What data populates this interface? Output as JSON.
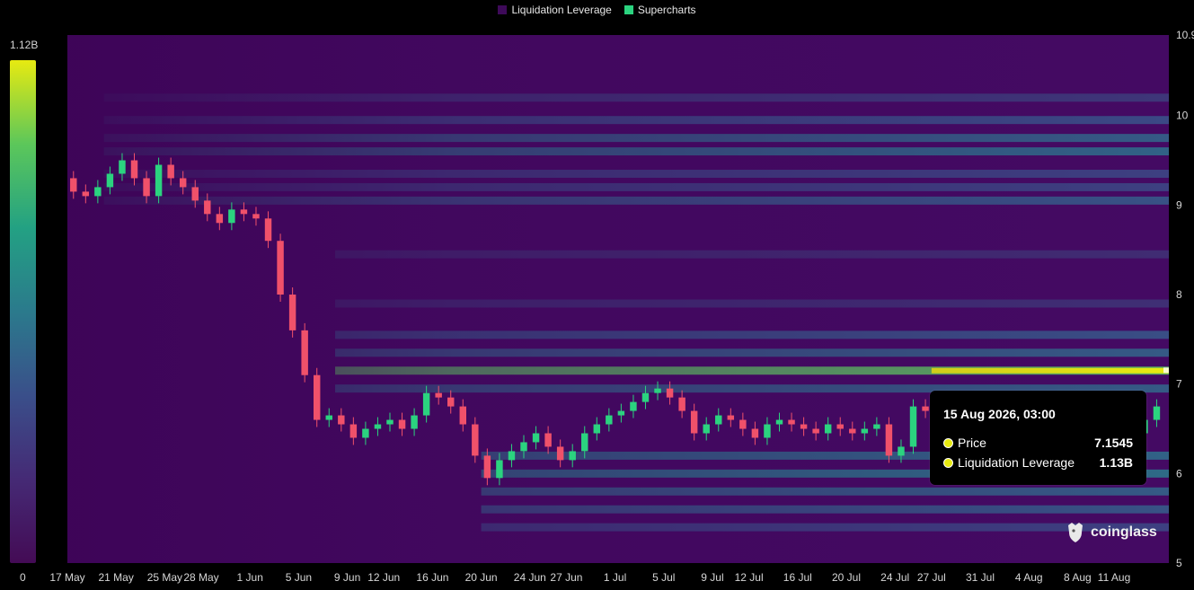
{
  "legend": [
    {
      "label": "Liquidation Leverage",
      "color": "#3e0a59"
    },
    {
      "label": "Supercharts",
      "color": "#2bd37f"
    }
  ],
  "colorbar": {
    "max_label": "1.12B",
    "min_label": "0",
    "colors": [
      "#e7ea11",
      "#5cc75a",
      "#23a183",
      "#2b7a8c",
      "#3a4f8a",
      "#452a75",
      "#440b55"
    ]
  },
  "tooltip": {
    "title": "15 Aug 2026, 03:00",
    "rows": [
      {
        "label": "Price",
        "value": "7.1545",
        "color": "#e7ea11"
      },
      {
        "label": "Liquidation Leverage",
        "value": "1.13B",
        "color": "#e7ea11"
      }
    ]
  },
  "brand": {
    "name": "coinglass",
    "icon": "coinglass-logo-icon"
  },
  "chart_data": {
    "type": "heatmap",
    "title": "",
    "xlabel": "",
    "ylabel": "",
    "x_tick_labels": [
      "17 May",
      "21 May",
      "25 May",
      "28 May",
      "1 Jun",
      "5 Jun",
      "9 Jun",
      "12 Jun",
      "16 Jun",
      "20 Jun",
      "24 Jun",
      "27 Jun",
      "1 Jul",
      "5 Jul",
      "9 Jul",
      "12 Jul",
      "16 Jul",
      "20 Jul",
      "24 Jul",
      "27 Jul",
      "31 Jul",
      "4 Aug",
      "8 Aug",
      "11 Aug"
    ],
    "x_range_days": [
      0,
      90.5
    ],
    "x_tick_days": [
      0,
      4,
      8,
      11,
      15,
      19,
      23,
      26,
      30,
      34,
      38,
      41,
      45,
      49,
      53,
      56,
      60,
      64,
      68,
      71,
      75,
      79,
      83,
      86
    ],
    "y_tick_labels": [
      "10.9",
      "10",
      "9",
      "8",
      "7",
      "6",
      "5"
    ],
    "y_tick_values": [
      10.9,
      10,
      9,
      8,
      7,
      6,
      5
    ],
    "ylim": [
      5,
      10.9
    ],
    "colorscale_max": 1120000000,
    "price_series": {
      "name": "Price",
      "points": [
        [
          0,
          9.3
        ],
        [
          1,
          9.15
        ],
        [
          2,
          9.1
        ],
        [
          3,
          9.2
        ],
        [
          4,
          9.35
        ],
        [
          5,
          9.5
        ],
        [
          6,
          9.3
        ],
        [
          7,
          9.1
        ],
        [
          8,
          9.45
        ],
        [
          9,
          9.3
        ],
        [
          10,
          9.2
        ],
        [
          11,
          9.05
        ],
        [
          12,
          8.9
        ],
        [
          13,
          8.8
        ],
        [
          14,
          8.95
        ],
        [
          15,
          8.9
        ],
        [
          16,
          8.85
        ],
        [
          17,
          8.6
        ],
        [
          18,
          8.0
        ],
        [
          19,
          7.6
        ],
        [
          20,
          7.1
        ],
        [
          21,
          6.6
        ],
        [
          22,
          6.65
        ],
        [
          23,
          6.55
        ],
        [
          24,
          6.4
        ],
        [
          25,
          6.5
        ],
        [
          26,
          6.55
        ],
        [
          27,
          6.6
        ],
        [
          28,
          6.5
        ],
        [
          29,
          6.65
        ],
        [
          30,
          6.9
        ],
        [
          31,
          6.85
        ],
        [
          32,
          6.75
        ],
        [
          33,
          6.55
        ],
        [
          34,
          6.2
        ],
        [
          35,
          5.95
        ],
        [
          36,
          6.15
        ],
        [
          37,
          6.25
        ],
        [
          38,
          6.35
        ],
        [
          39,
          6.45
        ],
        [
          40,
          6.3
        ],
        [
          41,
          6.15
        ],
        [
          42,
          6.25
        ],
        [
          43,
          6.45
        ],
        [
          44,
          6.55
        ],
        [
          45,
          6.65
        ],
        [
          46,
          6.7
        ],
        [
          47,
          6.8
        ],
        [
          48,
          6.9
        ],
        [
          49,
          6.95
        ],
        [
          50,
          6.85
        ],
        [
          51,
          6.7
        ],
        [
          52,
          6.45
        ],
        [
          53,
          6.55
        ],
        [
          54,
          6.65
        ],
        [
          55,
          6.6
        ],
        [
          56,
          6.5
        ],
        [
          57,
          6.4
        ],
        [
          58,
          6.55
        ],
        [
          59,
          6.6
        ],
        [
          60,
          6.55
        ],
        [
          61,
          6.5
        ],
        [
          62,
          6.45
        ],
        [
          63,
          6.55
        ],
        [
          64,
          6.5
        ],
        [
          65,
          6.45
        ],
        [
          66,
          6.5
        ],
        [
          67,
          6.55
        ],
        [
          68,
          6.2
        ],
        [
          69,
          6.3
        ],
        [
          70,
          6.75
        ],
        [
          71,
          6.7
        ],
        [
          72,
          6.65
        ],
        [
          73,
          6.75
        ],
        [
          74,
          6.8
        ],
        [
          75,
          6.7
        ],
        [
          76,
          6.6
        ],
        [
          77,
          6.65
        ],
        [
          78,
          6.6
        ],
        [
          79,
          6.5
        ],
        [
          80,
          6.55
        ],
        [
          81,
          6.6
        ],
        [
          82,
          6.55
        ],
        [
          83,
          6.6
        ],
        [
          84,
          6.5
        ],
        [
          85,
          6.45
        ],
        [
          86,
          6.5
        ],
        [
          87,
          6.55
        ],
        [
          88,
          6.45
        ],
        [
          89,
          6.6
        ],
        [
          90,
          6.75
        ]
      ]
    },
    "liquidation_bands": [
      {
        "price": 10.2,
        "intensity": 0.25
      },
      {
        "price": 9.95,
        "intensity": 0.35
      },
      {
        "price": 9.75,
        "intensity": 0.45
      },
      {
        "price": 9.6,
        "intensity": 0.5
      },
      {
        "price": 9.35,
        "intensity": 0.3
      },
      {
        "price": 9.2,
        "intensity": 0.3
      },
      {
        "price": 9.05,
        "intensity": 0.4
      },
      {
        "price": 8.45,
        "intensity": 0.2
      },
      {
        "price": 7.9,
        "intensity": 0.22
      },
      {
        "price": 7.55,
        "intensity": 0.38
      },
      {
        "price": 7.35,
        "intensity": 0.45
      },
      {
        "price": 7.15,
        "intensity": 1.0
      },
      {
        "price": 6.95,
        "intensity": 0.45
      },
      {
        "price": 6.2,
        "intensity": 0.5
      },
      {
        "price": 6.0,
        "intensity": 0.55
      },
      {
        "price": 5.8,
        "intensity": 0.45
      },
      {
        "price": 5.6,
        "intensity": 0.4
      },
      {
        "price": 5.4,
        "intensity": 0.3
      }
    ]
  }
}
